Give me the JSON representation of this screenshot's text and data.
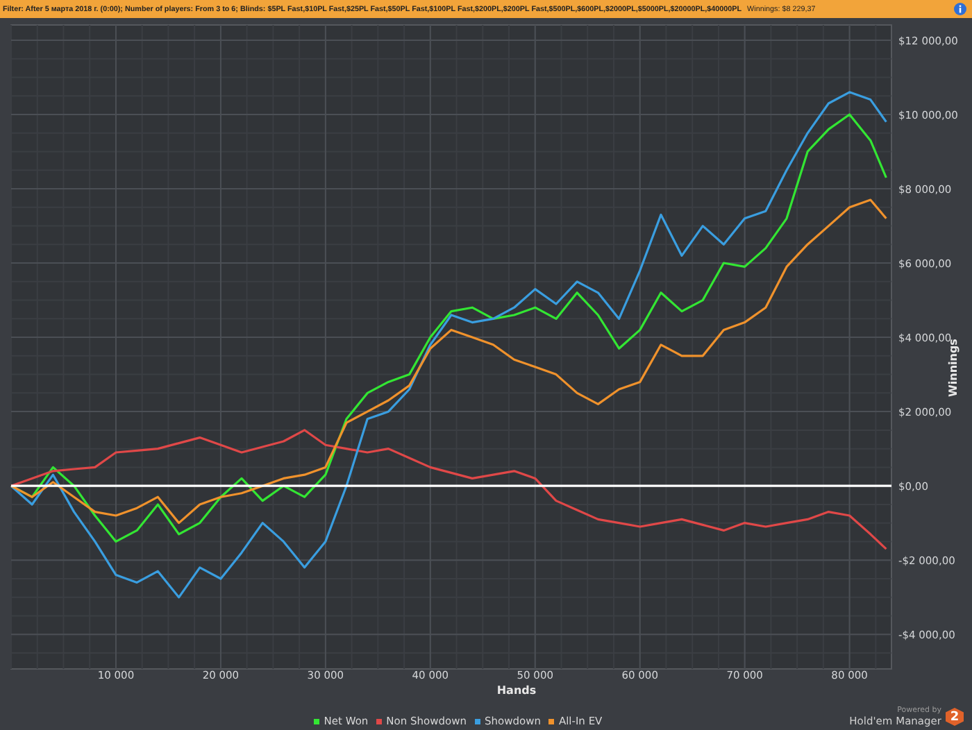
{
  "filter_bar": {
    "filter_text": "Filter: After 5 марта 2018 г. (0:00); Number of players: From 3 to 6; Blinds: $5PL Fast,$10PL Fast,$25PL Fast,$50PL Fast,$100PL Fast,$200PL,$200PL Fast,$500PL,$600PL,$2000PL,$5000PL,$20000PL,$40000PL",
    "winnings_text": "Winnings: $8 229,37"
  },
  "chart": {
    "chart_data": {
      "type": "line",
      "xlabel": "Hands",
      "ylabel": "Winnings",
      "x": [
        0,
        2000,
        4000,
        6000,
        8000,
        10000,
        12000,
        14000,
        16000,
        18000,
        20000,
        22000,
        24000,
        26000,
        28000,
        30000,
        32000,
        34000,
        36000,
        38000,
        40000,
        42000,
        44000,
        46000,
        48000,
        50000,
        52000,
        54000,
        56000,
        58000,
        60000,
        62000,
        64000,
        66000,
        68000,
        70000,
        72000,
        74000,
        76000,
        78000,
        80000,
        82000,
        83500
      ],
      "xlim": [
        0,
        84000
      ],
      "ylim": [
        -4930,
        12410
      ],
      "grid": true,
      "xticks": [
        {
          "value": 10000,
          "label": "10 000"
        },
        {
          "value": 20000,
          "label": "20 000"
        },
        {
          "value": 30000,
          "label": "30 000"
        },
        {
          "value": 40000,
          "label": "40 000"
        },
        {
          "value": 50000,
          "label": "50 000"
        },
        {
          "value": 60000,
          "label": "60 000"
        },
        {
          "value": 70000,
          "label": "70 000"
        },
        {
          "value": 80000,
          "label": "80 000"
        }
      ],
      "yticks": [
        {
          "value": -4000,
          "label": "-$4 000,00"
        },
        {
          "value": -2000,
          "label": "-$2 000,00"
        },
        {
          "value": 0,
          "label": "$0,00"
        },
        {
          "value": 2000,
          "label": "$2 000,00"
        },
        {
          "value": 4000,
          "label": "$4 000,00"
        },
        {
          "value": 6000,
          "label": "$6 000,00"
        },
        {
          "value": 8000,
          "label": "$8 000,00"
        },
        {
          "value": 10000,
          "label": "$10 000,00"
        },
        {
          "value": 12000,
          "label": "$12 000,00"
        }
      ],
      "series": [
        {
          "name": "Net Won",
          "color": "#33e633",
          "values": [
            0,
            -300,
            500,
            0,
            -800,
            -1500,
            -1200,
            -500,
            -1300,
            -1000,
            -300,
            200,
            -400,
            0,
            -300,
            300,
            1800,
            2500,
            2800,
            3000,
            4000,
            4700,
            4800,
            4500,
            4600,
            4800,
            4500,
            5200,
            4600,
            3700,
            4200,
            5200,
            4700,
            5000,
            6000,
            5900,
            6400,
            7200,
            9000,
            9600,
            10000,
            9300,
            8300
          ]
        },
        {
          "name": "Non Showdown",
          "color": "#e04848",
          "values": [
            0,
            200,
            400,
            450,
            500,
            900,
            950,
            1000,
            1150,
            1300,
            1100,
            900,
            1050,
            1200,
            1500,
            1100,
            1000,
            900,
            1000,
            750,
            500,
            350,
            200,
            300,
            400,
            200,
            -400,
            -650,
            -900,
            -1000,
            -1100,
            -1000,
            -900,
            -1050,
            -1200,
            -1000,
            -1100,
            -1000,
            -900,
            -700,
            -800,
            -1300,
            -1700
          ]
        },
        {
          "name": "Showdown",
          "color": "#3a9ee0",
          "values": [
            0,
            -500,
            300,
            -700,
            -1500,
            -2400,
            -2600,
            -2300,
            -3000,
            -2200,
            -2500,
            -1800,
            -1000,
            -1500,
            -2200,
            -1500,
            0,
            1800,
            2000,
            2600,
            3800,
            4600,
            4400,
            4500,
            4800,
            5300,
            4900,
            5500,
            5200,
            4500,
            5800,
            7300,
            6200,
            7000,
            6500,
            7200,
            7400,
            8500,
            9500,
            10300,
            10600,
            10400,
            9800
          ]
        },
        {
          "name": "All-In EV",
          "color": "#f0922c",
          "values": [
            0,
            -300,
            100,
            -300,
            -700,
            -800,
            -600,
            -300,
            -1000,
            -500,
            -300,
            -200,
            0,
            200,
            300,
            500,
            1700,
            2000,
            2300,
            2700,
            3700,
            4200,
            4000,
            3800,
            3400,
            3200,
            3000,
            2500,
            2200,
            2600,
            2800,
            3800,
            3500,
            3500,
            4200,
            4400,
            4800,
            5900,
            6500,
            7000,
            7500,
            7700,
            7200
          ]
        }
      ]
    }
  },
  "logo": {
    "caption": "Powered by",
    "name": "Hold'em Manager",
    "badge": "2"
  }
}
